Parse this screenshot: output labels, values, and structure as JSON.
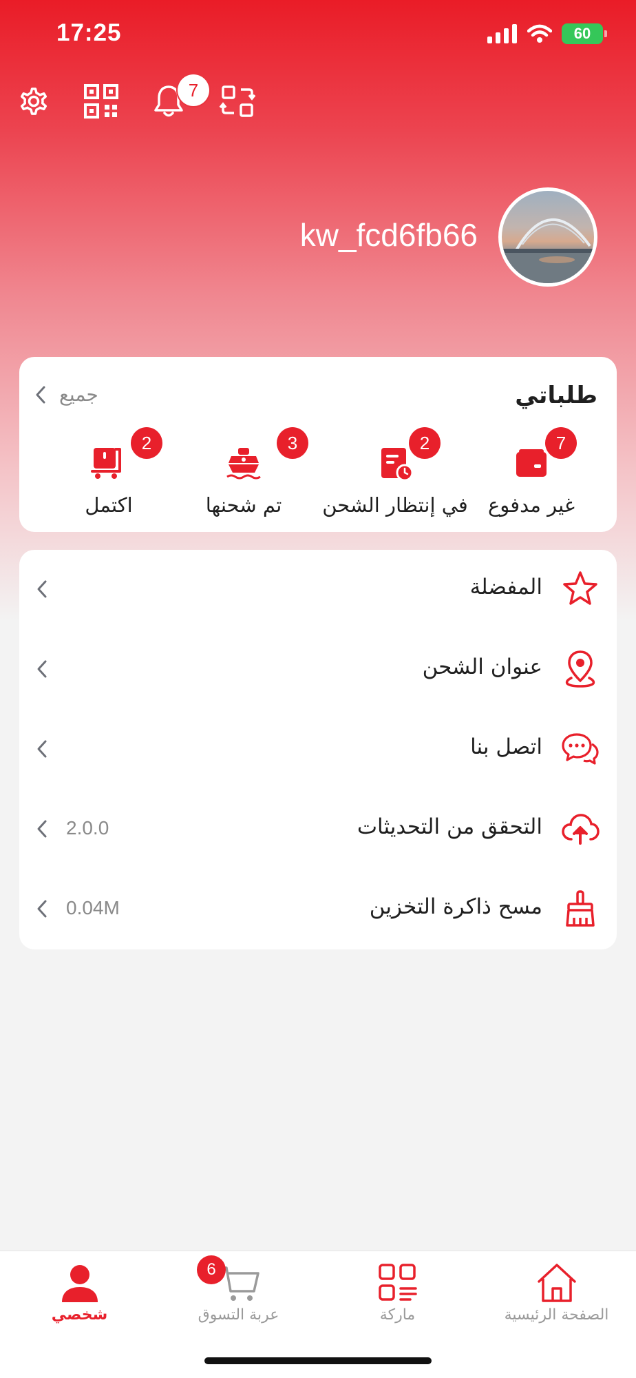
{
  "status_bar": {
    "time": "17:25",
    "battery": "60"
  },
  "header": {
    "notification_count": "7"
  },
  "profile": {
    "username": "kw_fcd6fb66"
  },
  "orders": {
    "title": "طلباتي",
    "all_label": "جميع",
    "items": [
      {
        "label": "غير مدفوع",
        "count": "7",
        "icon": "wallet-icon"
      },
      {
        "label": "في إنتظار الشحن",
        "count": "2",
        "icon": "pending-shipment-icon"
      },
      {
        "label": "تم شحنها",
        "count": "3",
        "icon": "ship-icon"
      },
      {
        "label": "اكتمل",
        "count": "2",
        "icon": "delivered-cart-icon"
      }
    ]
  },
  "menu": {
    "items": [
      {
        "label": "المفضلة",
        "icon": "star-icon",
        "value": ""
      },
      {
        "label": "عنوان الشحن",
        "icon": "location-pin-icon",
        "value": ""
      },
      {
        "label": "اتصل بنا",
        "icon": "chat-bubbles-icon",
        "value": ""
      },
      {
        "label": "التحقق من التحديثات",
        "icon": "cloud-upload-icon",
        "value": "2.0.0"
      },
      {
        "label": "مسح ذاكرة التخزين",
        "icon": "broom-icon",
        "value": "0.04M"
      }
    ]
  },
  "bottom_nav": {
    "cart_count": "6",
    "items": [
      {
        "label": "شخصي",
        "icon": "person-icon",
        "active": true
      },
      {
        "label": "عربة التسوق",
        "icon": "cart-icon",
        "active": false
      },
      {
        "label": "ماركة",
        "icon": "brand-grid-icon",
        "active": false
      },
      {
        "label": "الصفحة الرئيسية",
        "icon": "home-icon",
        "active": false
      }
    ]
  },
  "colors": {
    "accent": "#e8202b",
    "header_top": "#ea1c27",
    "background": "#f3f3f3"
  }
}
